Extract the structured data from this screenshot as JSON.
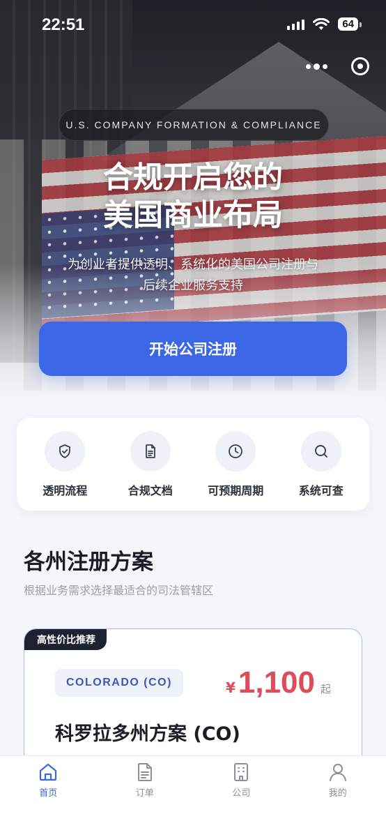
{
  "status_bar": {
    "time": "22:51",
    "battery": "64"
  },
  "capsule": {
    "more_icon": "more-dots-icon",
    "close_icon": "target-circle-icon"
  },
  "hero": {
    "badge": "U.S. COMPANY FORMATION & COMPLIANCE",
    "title_line1": "合规开启您的",
    "title_line2": "美国商业布局",
    "subtitle_line1": "为创业者提供透明、系统化的美国公司注册与",
    "subtitle_line2": "后续企业服务支持",
    "cta_label": "开始公司注册"
  },
  "features": [
    {
      "icon": "shield-check-icon",
      "label": "透明流程"
    },
    {
      "icon": "document-icon",
      "label": "合规文档"
    },
    {
      "icon": "clock-icon",
      "label": "可预期周期"
    },
    {
      "icon": "search-icon",
      "label": "系统可查"
    }
  ],
  "section": {
    "title": "各州注册方案",
    "subtitle": "根据业务需求选择最适合的司法管辖区"
  },
  "plan": {
    "tag": "高性价比推荐",
    "state": "COLORADO (CO)",
    "currency": "¥",
    "price": "1,100",
    "price_suffix": "起",
    "name": "科罗拉多州方案 (CO)"
  },
  "tabbar": {
    "items": [
      {
        "icon": "home-icon",
        "label": "首页",
        "active": true
      },
      {
        "icon": "order-icon",
        "label": "订单",
        "active": false
      },
      {
        "icon": "company-building-icon",
        "label": "公司",
        "active": false
      },
      {
        "icon": "profile-icon",
        "label": "我的",
        "active": false
      }
    ]
  },
  "colors": {
    "accent": "#3b66e6",
    "price": "#de4c5b",
    "tag_bg": "#1d2130"
  }
}
